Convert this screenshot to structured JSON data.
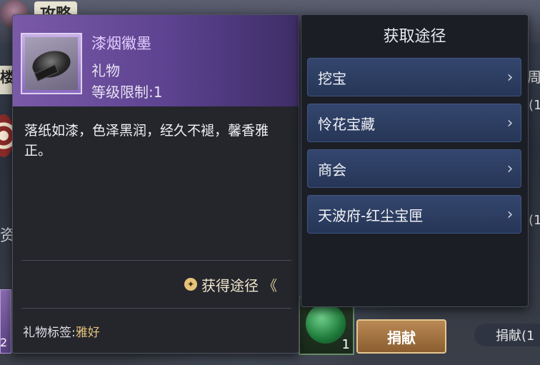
{
  "background": {
    "title": "攻略",
    "left_tab": "楼",
    "left_text": "资",
    "right_text_1": "周",
    "right_text_2": "(1",
    "right_text_3": "(1",
    "left_card_count": "2",
    "jade_count": "1",
    "donate_label": "捐献",
    "donate_right_label": "捐献(1"
  },
  "item": {
    "name": "漆烟徽墨",
    "type": "礼物",
    "level_label": "等级限制:1",
    "description": "落纸如漆，色泽黑润，经久不褪，馨香雅正。",
    "acquire_label": "获得途径",
    "acquire_chevron": "《",
    "gift_tag_label": "礼物标签:",
    "gift_tag_value": "雅好",
    "name_color": "#e4ceff",
    "rarity_color": "#7a5aa8"
  },
  "sources": {
    "title": "获取途径",
    "items": [
      {
        "label": "挖宝"
      },
      {
        "label": "怜花宝藏"
      },
      {
        "label": "商会"
      },
      {
        "label": "天波府-红尘宝匣"
      }
    ],
    "chevron_icon": "›"
  }
}
